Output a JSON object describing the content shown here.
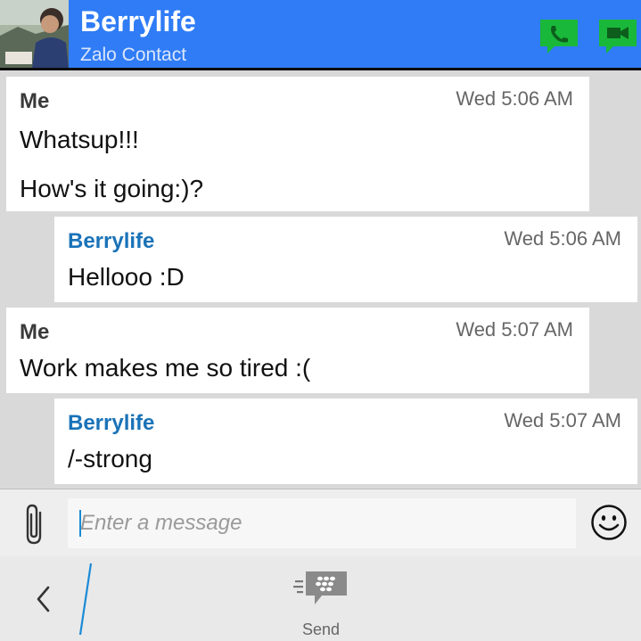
{
  "header": {
    "contact_name": "Berrylife",
    "contact_subtitle": "Zalo Contact",
    "accent_color": "#2f7cf6",
    "call_icon": "phone-icon",
    "video_icon": "video-chat-icon",
    "action_icon_color": "#19b83a"
  },
  "messages": [
    {
      "sender": "Me",
      "time": "Wed 5:06 AM",
      "lines": [
        "Whatsup!!!",
        "How's it going:)?"
      ]
    },
    {
      "sender": "Berrylife",
      "time": "Wed 5:06 AM",
      "lines": [
        "Hellooo :D"
      ]
    },
    {
      "sender": "Me",
      "time": "Wed 5:07 AM",
      "lines": [
        "Work makes me so tired :("
      ]
    },
    {
      "sender": "Berrylife",
      "time": "Wed 5:07 AM",
      "lines": [
        "/-strong"
      ]
    }
  ],
  "composer": {
    "placeholder": "Enter a message",
    "value": "",
    "attach_icon": "paperclip-icon",
    "emoji_icon": "smiley-icon"
  },
  "actionbar": {
    "back_icon": "chevron-left-icon",
    "send_label": "Send",
    "send_icon": "bbm-send-icon"
  }
}
